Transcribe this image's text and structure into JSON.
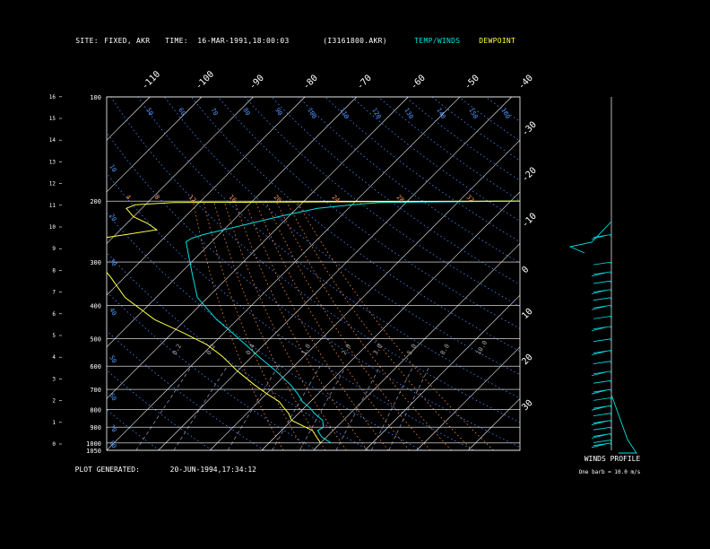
{
  "header": {
    "site_label": "SITE:",
    "site_value": "FIXED, AKR",
    "time_label": "TIME:",
    "time_value": "16-MAR-1991,18:00:03",
    "file_name": "(I3161800.AKR)",
    "temp_winds_label": "TEMP/WINDS",
    "dewpoint_label": "DEWPOINT"
  },
  "footer": {
    "plot_generated_label": "PLOT GENERATED:",
    "plot_generated_value": "20-JUN-1994,17:34:12"
  },
  "colors": {
    "background": "#000000",
    "frame": "#ffffff",
    "temperature": "#00e0e0",
    "dewpoint": "#ffff44",
    "isotherm": "#ffffff",
    "dry_adiabat": "#4488ff",
    "moist_adiabat": "#ff8c40",
    "mixing_ratio": "#8888aa",
    "winds": "#00e0e0",
    "label_orange": "#ff9955",
    "label_blue": "#5599ff"
  },
  "chart_data": {
    "type": "line",
    "subtype": "skew-T log-P",
    "pressure_levels": [
      100,
      200,
      300,
      400,
      500,
      600,
      700,
      800,
      900,
      1000,
      1050
    ],
    "pressure_tick_labels": [
      "100",
      "200",
      "300",
      "400",
      "500",
      "600",
      "700",
      "800",
      "900",
      "1000",
      "1050"
    ],
    "height_km_ticks": [
      "0",
      "1",
      "2",
      "3",
      "4",
      "5",
      "6",
      "7",
      "8",
      "9",
      "10",
      "11",
      "12",
      "13",
      "14",
      "15",
      "16"
    ],
    "top_temperature_labels": [
      "-110",
      "-100",
      "-90",
      "-80",
      "-70",
      "-60",
      "-50",
      "-40"
    ],
    "top_temperature_values": [
      -110,
      -100,
      -90,
      -80,
      -70,
      -60,
      -50,
      -40
    ],
    "right_temperature_labels": [
      "-30",
      "-20",
      "-10",
      "0",
      "10",
      "20",
      "30"
    ],
    "right_temperature_values": [
      -30,
      -20,
      -10,
      0,
      10,
      20,
      30
    ],
    "dry_adiabat_labels": [
      "50",
      "50",
      "60",
      "70",
      "80",
      "90",
      "100",
      "110",
      "120",
      "130",
      "140",
      "150",
      "160"
    ],
    "moist_adiabat_labels": [
      "4",
      "8",
      "12",
      "16",
      "20",
      "24",
      "28",
      "32"
    ],
    "mixing_ratio_labels": [
      "0.2",
      "0.2",
      "0.4",
      "1.0",
      "2.0",
      "3.0",
      "5.0",
      "8.0",
      "10.0"
    ],
    "left_theta_labels": [
      "10",
      "20",
      "30",
      "40",
      "50",
      "60",
      "70",
      "80"
    ],
    "series": [
      {
        "name": "TEMP/WINDS",
        "color": "#00e0e0",
        "p": [
          1000,
          960,
          920,
          900,
          860,
          820,
          790,
          760,
          720,
          680,
          620,
          560,
          520,
          480,
          440,
          380,
          330,
          290,
          262,
          256,
          250,
          242,
          232,
          222,
          210,
          205,
          202,
          200
        ],
        "t": [
          2.0,
          -1.0,
          -3.0,
          -2.5,
          -4.0,
          -7.0,
          -9.0,
          -11.5,
          -14.0,
          -17.0,
          -22.5,
          -29.0,
          -33.5,
          -38.5,
          -44.0,
          -52.0,
          -57.0,
          -61.5,
          -65.0,
          -64.5,
          -63.0,
          -60.0,
          -56.0,
          -52.0,
          -46.0,
          -40.0,
          -35.0,
          0.0
        ]
      },
      {
        "name": "DEWPOINT",
        "color": "#ffff44",
        "p": [
          1000,
          960,
          920,
          900,
          860,
          820,
          790,
          760,
          720,
          680,
          620,
          560,
          520,
          480,
          440,
          380,
          330,
          290,
          262,
          256,
          250,
          242,
          232,
          222,
          210,
          205,
          202,
          200
        ],
        "t": [
          0.0,
          -2.0,
          -4.0,
          -6.0,
          -10.0,
          -12.0,
          -14.0,
          -16.0,
          -20.0,
          -24.0,
          -30.0,
          -36.0,
          -41.0,
          -48.0,
          -56.0,
          -66.0,
          -73.0,
          -80.0,
          -85.0,
          -82.0,
          -78.0,
          -73.0,
          -76.0,
          -80.0,
          -83.0,
          -82.0,
          -75.0,
          0.0
        ]
      }
    ],
    "winds_profile": {
      "title": "WINDS PROFILE",
      "barb_note": "One barb = 10.0 m/s",
      "levels": [
        "p250",
        "p300",
        "p320",
        "p340",
        "p360",
        "p380",
        "p400",
        "p430",
        "p460",
        "p500",
        "p540",
        "p580",
        "p620",
        "p660",
        "p700",
        "p740",
        "p780",
        "p820",
        "p860",
        "p900",
        "p940",
        "p980",
        "p1000"
      ]
    },
    "xlim": [
      -40,
      40
    ],
    "ylim": [
      1050,
      100
    ],
    "yscale": "log"
  }
}
